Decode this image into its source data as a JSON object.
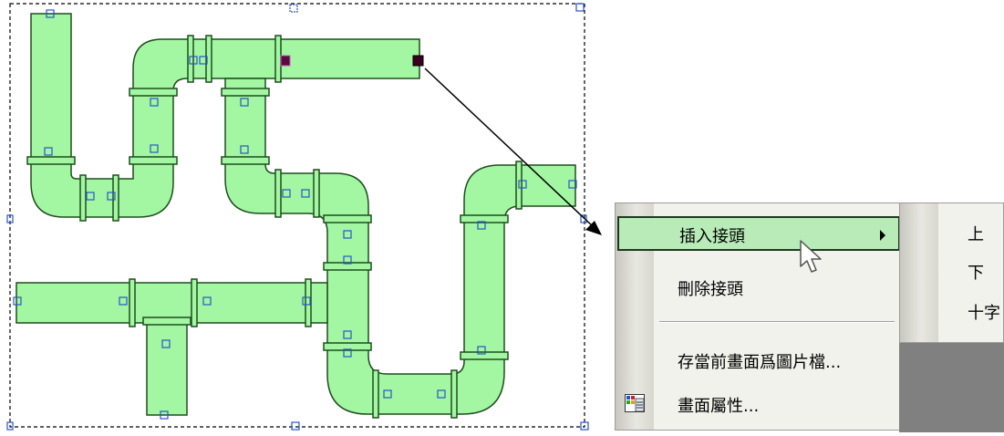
{
  "context_menu": {
    "items": [
      {
        "label": "插入接頭",
        "has_submenu": true,
        "highlighted": true
      },
      {
        "label": "刪除接頭",
        "has_submenu": false,
        "highlighted": false
      },
      {
        "label": "存當前畫面爲圖片檔...",
        "has_submenu": false,
        "highlighted": false
      },
      {
        "label": "畫面屬性...",
        "has_submenu": false,
        "highlighted": false,
        "icon": "properties-icon"
      }
    ]
  },
  "submenu": {
    "items": [
      {
        "label": "上"
      },
      {
        "label": "下"
      },
      {
        "label": "十字"
      }
    ]
  },
  "colors": {
    "pipe_fill": "#a3f7a3",
    "pipe_stroke": "#1e4d1e",
    "handle_stroke": "#2a55c8",
    "selected_handle": "#5a0a3c",
    "menu_highlight": "#b8ebb8"
  }
}
